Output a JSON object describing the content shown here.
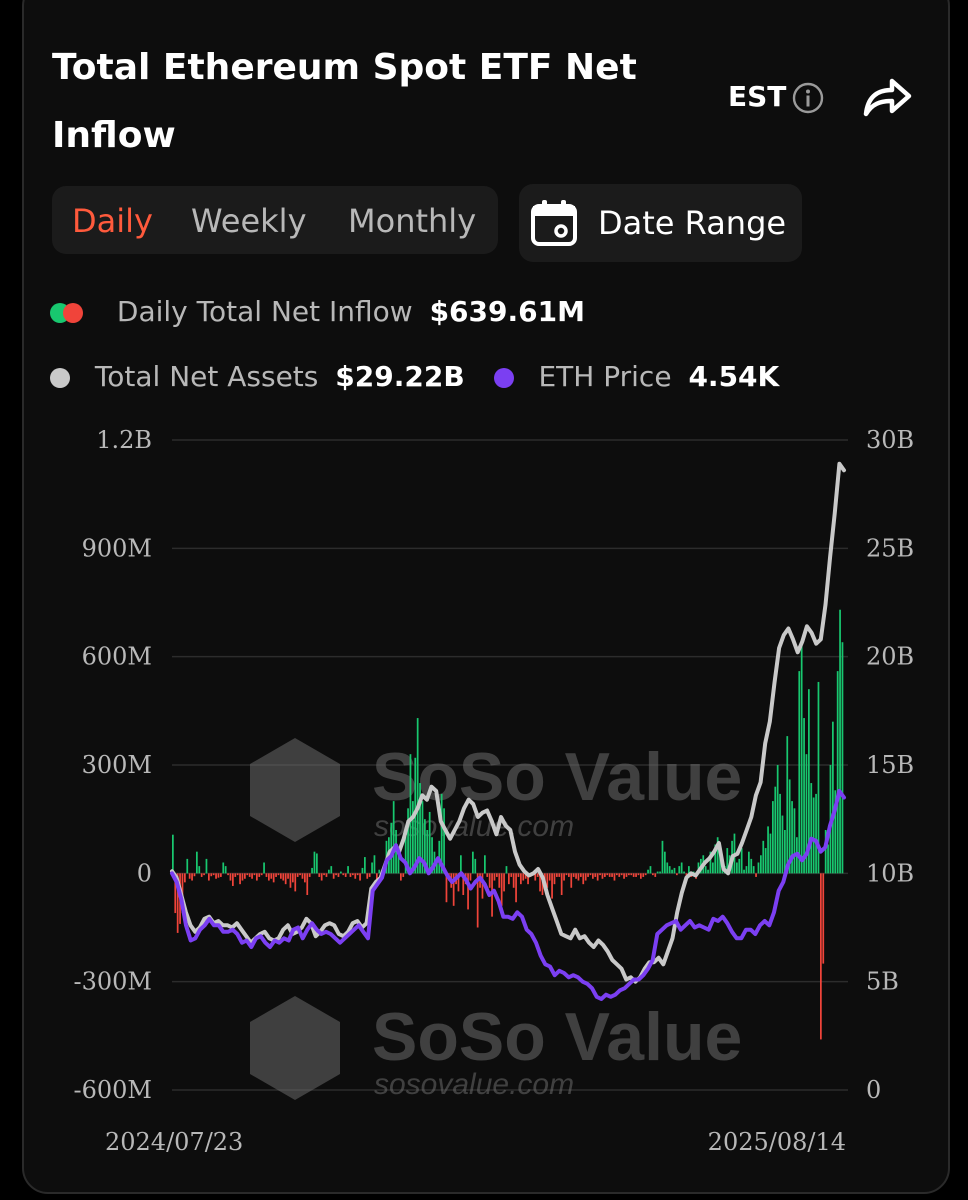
{
  "header": {
    "title": "Total Ethereum Spot ETF Net Inflow",
    "timezone": "EST"
  },
  "tabs": [
    {
      "label": "Daily",
      "active": true
    },
    {
      "label": "Weekly",
      "active": false
    },
    {
      "label": "Monthly",
      "active": false
    }
  ],
  "date_range_label": "Date Range",
  "legend": {
    "inflow": {
      "label": "Daily Total Net Inflow",
      "value": "$639.61M"
    },
    "assets": {
      "label": "Total Net Assets",
      "value": "$29.22B"
    },
    "price": {
      "label": "ETH Price",
      "value": "4.54K"
    }
  },
  "watermark": {
    "brand": "SoSo Value",
    "url": "sosovalue.com"
  },
  "colors": {
    "accent": "#ff5a3c",
    "inflow_positive": "#18c76f",
    "inflow_negative": "#f0443a",
    "assets_line": "#c9c9c9",
    "price_line": "#7b3ff2"
  },
  "chart_data": {
    "type": "bar",
    "x_start": "2024/07/23",
    "x_end": "2025/08/14",
    "left_axis": {
      "ticks": [
        "1.2B",
        "900M",
        "600M",
        "300M",
        "0",
        "-300M",
        "-600M"
      ],
      "range": [
        -600,
        1200
      ],
      "unit": "M"
    },
    "right_axis": {
      "ticks": [
        "30B",
        "25B",
        "20B",
        "15B",
        "10B",
        "5B",
        "0"
      ],
      "range": [
        0,
        30
      ],
      "unit": "B"
    },
    "grid": true,
    "series": [
      {
        "name": "Daily Total Net Inflow",
        "type": "bar",
        "values": [
          107,
          -110,
          -165,
          -140,
          -110,
          -25,
          40,
          -15,
          -20,
          -8,
          60,
          20,
          -10,
          -5,
          40,
          -20,
          -8,
          -5,
          -15,
          -12,
          -10,
          30,
          20,
          -5,
          -20,
          -35,
          -10,
          -5,
          -30,
          -20,
          -15,
          -5,
          -10,
          -15,
          -5,
          -20,
          -10,
          -5,
          30,
          -10,
          -20,
          -15,
          -25,
          -10,
          -5,
          -15,
          -20,
          -30,
          -15,
          -40,
          -25,
          -50,
          -10,
          -5,
          -15,
          -25,
          -60,
          -10,
          15,
          60,
          55,
          -10,
          -20,
          -5,
          -10,
          10,
          20,
          -15,
          -5,
          -10,
          5,
          -5,
          -10,
          20,
          -10,
          -5,
          -15,
          -5,
          -20,
          15,
          45,
          -15,
          -10,
          30,
          50,
          -20,
          10,
          -5,
          20,
          90,
          100,
          140,
          200,
          120,
          60,
          -20,
          -10,
          120,
          180,
          330,
          200,
          320,
          430,
          250,
          200,
          150,
          120,
          170,
          100,
          60,
          40,
          90,
          220,
          180,
          -80,
          -20,
          -40,
          -90,
          -30,
          -50,
          50,
          -60,
          -30,
          -100,
          -20,
          60,
          40,
          -150,
          -40,
          -70,
          50,
          -10,
          -40,
          -120,
          -20,
          -10,
          -40,
          -90,
          -50,
          20,
          -30,
          -10,
          -40,
          -80,
          -10,
          -30,
          -20,
          -15,
          -30,
          -10,
          -5,
          -20,
          -10,
          -50,
          -60,
          -30,
          -40,
          -20,
          -70,
          -30,
          -10,
          -10,
          -60,
          -20,
          -5,
          -10,
          -40,
          -10,
          -15,
          -20,
          -10,
          -30,
          -20,
          -10,
          -5,
          -15,
          -10,
          -20,
          -5,
          -15,
          -10,
          -5,
          -10,
          -10,
          -20,
          -5,
          -10,
          -5,
          -15,
          -10,
          -5,
          -5,
          -10,
          -10,
          -5,
          -15,
          -10,
          -5,
          10,
          20,
          -5,
          -10,
          5,
          5,
          90,
          60,
          30,
          20,
          10,
          15,
          -5,
          20,
          30,
          5,
          -10,
          20,
          -10,
          5,
          -15,
          30,
          40,
          50,
          20,
          10,
          60,
          30,
          80,
          100,
          60,
          40,
          20,
          70,
          50,
          90,
          110,
          30,
          40,
          70,
          10,
          20,
          60,
          40,
          20,
          -10,
          30,
          50,
          90,
          70,
          130,
          110,
          200,
          240,
          300,
          220,
          160,
          120,
          380,
          260,
          200,
          180,
          100,
          560,
          640,
          430,
          330,
          510,
          250,
          210,
          220,
          530,
          -460,
          -250,
          120,
          80,
          300,
          420,
          230,
          560,
          730,
          640
        ]
      },
      {
        "name": "Total Net Assets",
        "type": "line",
        "axis": "right",
        "values": [
          10.1,
          9.8,
          9.0,
          8.2,
          7.6,
          7.3,
          7.5,
          7.9,
          8.0,
          7.7,
          7.8,
          7.6,
          7.6,
          7.5,
          7.7,
          7.4,
          7.1,
          6.8,
          7.0,
          7.2,
          7.3,
          7.0,
          6.9,
          7.0,
          7.4,
          7.6,
          7.2,
          7.3,
          7.5,
          7.9,
          7.7,
          7.1,
          7.3,
          7.6,
          7.7,
          7.6,
          7.2,
          7.1,
          7.3,
          7.7,
          7.8,
          7.5,
          7.7,
          9.3,
          9.6,
          9.8,
          10.4,
          11.0,
          11.2,
          11.0,
          11.6,
          12.4,
          12.6,
          13.0,
          13.6,
          13.4,
          14.0,
          13.8,
          12.4,
          12.0,
          11.6,
          12.0,
          12.4,
          13.0,
          13.4,
          13.2,
          12.6,
          12.8,
          12.9,
          12.4,
          11.8,
          12.6,
          12.2,
          12.0,
          11.0,
          10.4,
          10.1,
          9.9,
          10.0,
          10.2,
          9.8,
          9.0,
          8.4,
          7.8,
          7.2,
          7.1,
          7.0,
          7.4,
          7.0,
          7.1,
          6.8,
          6.6,
          6.9,
          6.7,
          6.4,
          6.0,
          5.8,
          5.6,
          5.1,
          5.2,
          5.0,
          5.2,
          5.6,
          5.9,
          5.9,
          6.1,
          5.8,
          6.4,
          7.0,
          8.2,
          9.1,
          9.8,
          10.0,
          9.9,
          10.2,
          10.5,
          10.7,
          11.0,
          11.4,
          10.2,
          10.0,
          10.8,
          10.9,
          11.4,
          12.0,
          12.6,
          13.6,
          14.2,
          16.0,
          17.0,
          18.8,
          20.4,
          21.0,
          21.3,
          20.8,
          20.2,
          20.7,
          21.4,
          21.1,
          20.6,
          20.8,
          22.4,
          24.6,
          26.6,
          28.9,
          28.6
        ]
      },
      {
        "name": "ETH Price",
        "type": "line",
        "axis": "right",
        "values": [
          10.0,
          9.6,
          8.8,
          7.6,
          6.9,
          7.0,
          7.4,
          7.6,
          7.9,
          7.6,
          7.6,
          7.3,
          7.3,
          7.4,
          7.2,
          6.8,
          6.9,
          6.6,
          7.0,
          7.1,
          6.8,
          6.6,
          6.9,
          6.8,
          7.0,
          6.9,
          7.4,
          7.5,
          7.0,
          7.4,
          7.7,
          7.4,
          7.2,
          7.3,
          7.2,
          7.0,
          6.8,
          7.0,
          7.2,
          7.4,
          7.6,
          7.3,
          7.0,
          9.2,
          9.5,
          9.8,
          10.6,
          10.8,
          11.3,
          10.7,
          10.5,
          10.0,
          10.3,
          10.7,
          10.5,
          10.0,
          10.3,
          10.7,
          10.3,
          9.9,
          9.6,
          9.8,
          10.0,
          9.7,
          9.3,
          9.6,
          9.8,
          9.5,
          9.0,
          9.2,
          8.7,
          8.0,
          8.0,
          7.9,
          8.2,
          8.0,
          7.4,
          7.2,
          6.8,
          6.2,
          5.8,
          5.7,
          5.3,
          5.5,
          5.4,
          5.2,
          5.3,
          5.2,
          5.0,
          4.9,
          4.7,
          4.3,
          4.2,
          4.4,
          4.3,
          4.4,
          4.6,
          4.7,
          4.9,
          5.1,
          5.1,
          5.3,
          5.6,
          6.0,
          7.2,
          7.4,
          7.6,
          7.7,
          7.8,
          7.4,
          7.6,
          7.8,
          7.5,
          7.6,
          7.5,
          7.4,
          7.9,
          7.8,
          8.0,
          7.7,
          7.3,
          7.0,
          7.0,
          7.4,
          7.4,
          7.2,
          7.6,
          7.8,
          7.6,
          8.2,
          9.2,
          9.6,
          10.4,
          10.8,
          10.9,
          10.6,
          10.9,
          11.6,
          11.5,
          11.0,
          11.2,
          12.2,
          12.9,
          13.8,
          13.5
        ]
      }
    ]
  }
}
